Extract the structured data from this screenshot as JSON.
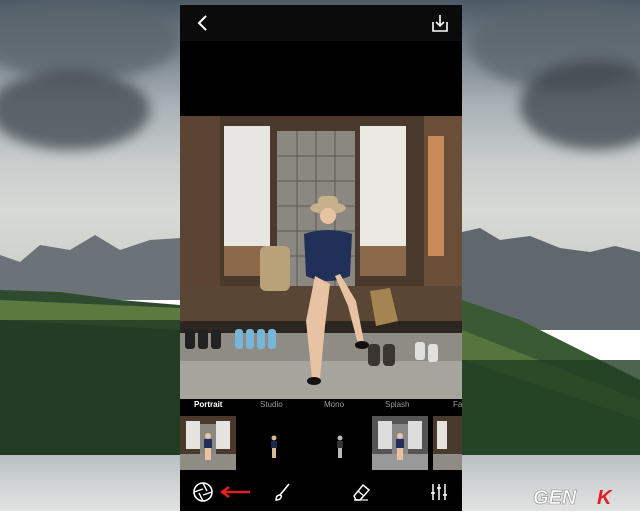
{
  "app": {
    "title_bar": {
      "back": "back",
      "save": "download"
    },
    "mode_tabs": [
      {
        "label": "Portrait",
        "active": true
      },
      {
        "label": "Studio",
        "active": false
      },
      {
        "label": "Mono",
        "active": false
      },
      {
        "label": "Splash",
        "active": false
      },
      {
        "label": "Fa",
        "active": false
      }
    ],
    "toolbar": {
      "items": [
        "camera-aperture-icon",
        "arrow-left-icon",
        "brush-icon",
        "eraser-icon",
        "sliders-icon"
      ]
    }
  },
  "watermark": {
    "text": "GENK"
  },
  "colors": {
    "screen_bg": "#000000",
    "annotation_arrow": "#e02020",
    "inactive_tab": "#9a9a9a"
  }
}
